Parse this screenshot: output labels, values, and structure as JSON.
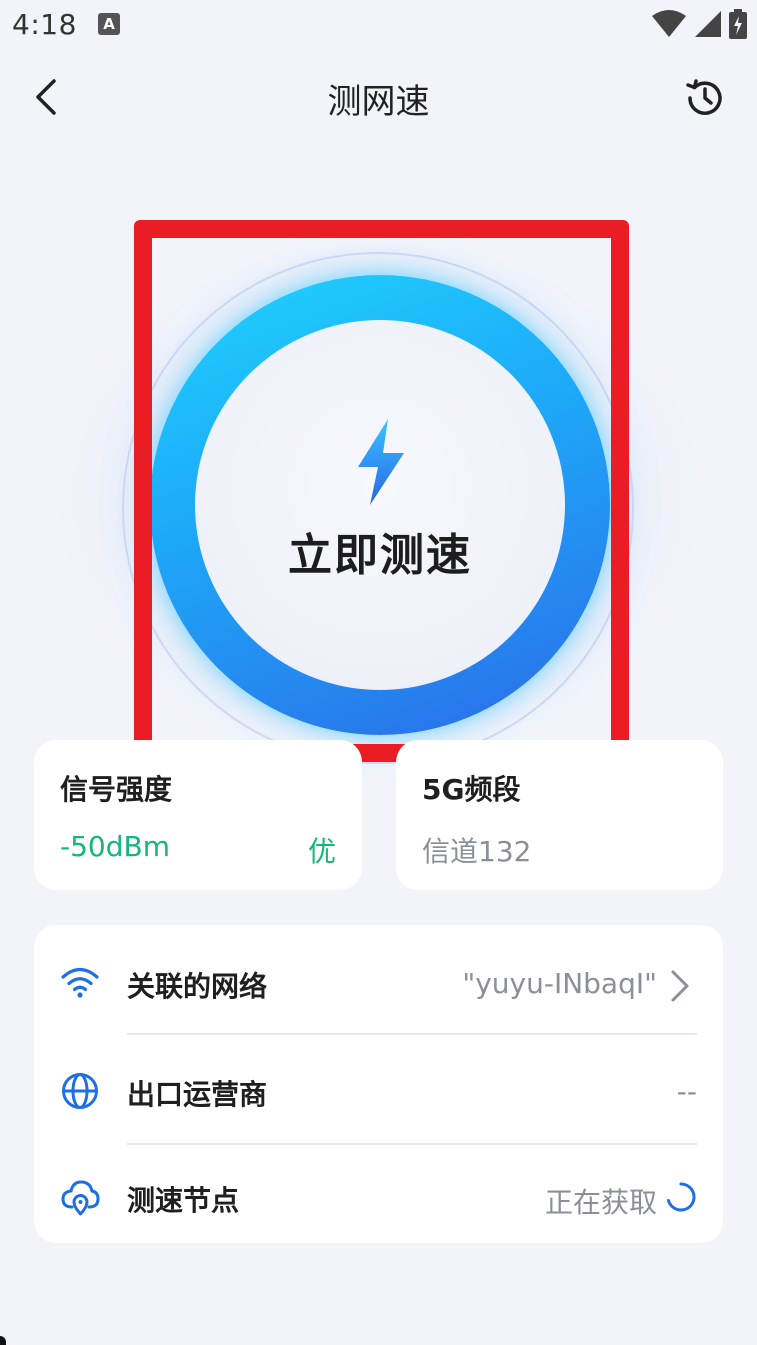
{
  "status_bar": {
    "time": "4:18",
    "notification_label": "A"
  },
  "header": {
    "title": "测网速"
  },
  "speed_test": {
    "start_label": "立即测速"
  },
  "signal_card": {
    "title": "信号强度",
    "value": "-50dBm",
    "level": "优"
  },
  "band_card": {
    "title": "5G频段",
    "channel": "信道132"
  },
  "network_list": {
    "items": [
      {
        "label": "关联的网络",
        "value": "\"yuyu-INbaqI\"",
        "icon": "wifi-icon"
      },
      {
        "label": "出口运营商",
        "value": "--",
        "icon": "globe-icon"
      },
      {
        "label": "测速节点",
        "value": "正在获取",
        "icon": "cloud-location-icon"
      }
    ]
  },
  "colors": {
    "accent_blue": "#1e6fe6",
    "ring_start": "#1fd3ff",
    "ring_end": "#2b6ce8",
    "good_green": "#13b77a",
    "highlight_red": "#ea1c24"
  }
}
